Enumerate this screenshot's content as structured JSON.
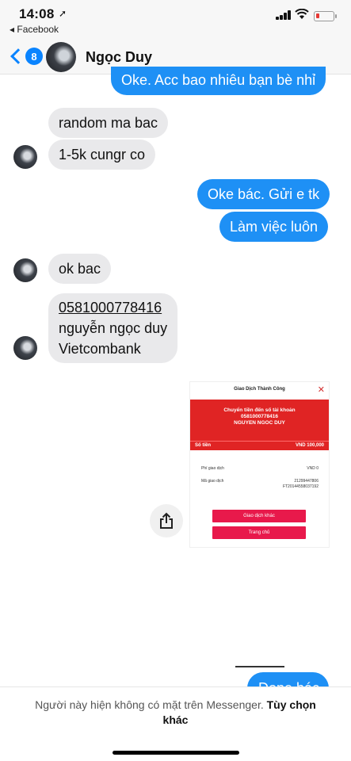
{
  "status_bar": {
    "time": "14:08",
    "location_glyph": "➚",
    "back_app": "◂ Facebook",
    "battery_color": "#e53935"
  },
  "header": {
    "unread_count": "8",
    "contact_name": "Ngọc Duy"
  },
  "messages": [
    {
      "side": "out",
      "text": "Oke. Acc bao nhiêu bạn bè nhỉ"
    },
    {
      "side": "in",
      "text": "random ma bac"
    },
    {
      "side": "in",
      "text": "1-5k cungr co"
    },
    {
      "side": "out",
      "text": "Oke bác. Gửi e tk"
    },
    {
      "side": "out",
      "text": "Làm việc luôn"
    },
    {
      "side": "in",
      "text": "ok bac"
    },
    {
      "side": "in",
      "lines": [
        "0581000778416",
        "nguyễn ngọc duy",
        "Vietcombank"
      ]
    },
    {
      "side": "out",
      "text": "Done bác"
    }
  ],
  "receipt": {
    "title": "Giao Dịch Thành Công",
    "close_glyph": "✕",
    "heading": [
      "Chuyển tiền đến số tài khoản",
      "0581000778416",
      "NGUYEN NGOC DUY"
    ],
    "amount_label": "Số tiền",
    "amount_value": "VND  100,000",
    "fee_label": "Phí giao dịch",
    "fee_value": "VND 0",
    "txn_label": "Mã giao dịch",
    "txn_values": [
      "21299447806",
      "FT20144558037192"
    ],
    "button_other": "Giao dịch khác",
    "button_home": "Trang chủ"
  },
  "footer": {
    "text": "Người này hiện không có mặt trên Messenger.",
    "link": "Tùy chọn khác"
  },
  "colors": {
    "messenger_blue": "#1e90f5",
    "incoming_gray": "#e9e9eb",
    "receipt_red": "#e02424",
    "receipt_button": "#e8194b"
  }
}
